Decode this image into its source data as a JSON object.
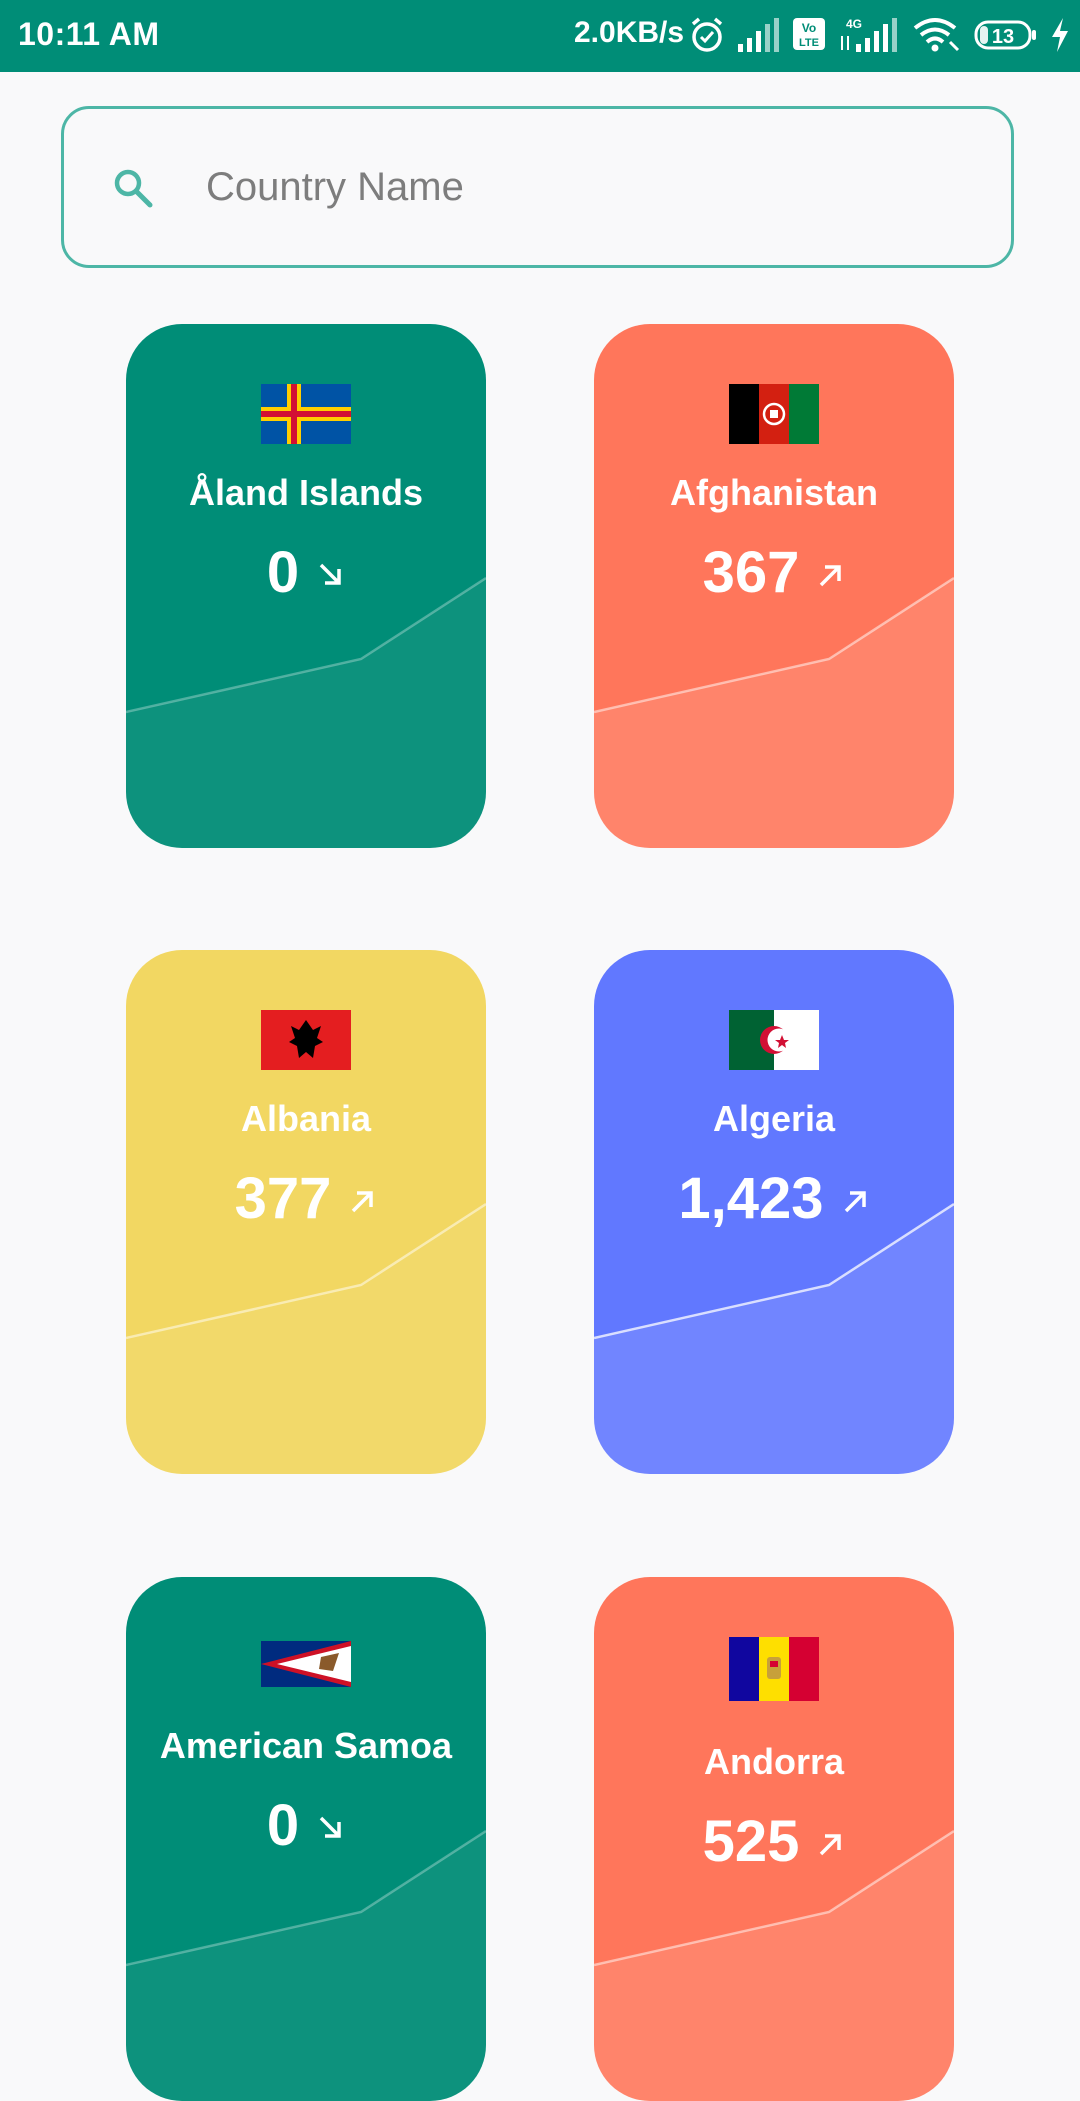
{
  "status_bar": {
    "time": "10:11 AM",
    "speed": "2.0KB/s",
    "battery": "13",
    "icons": [
      "alarm-icon",
      "signal-icon",
      "volte-icon",
      "4g-signal-icon",
      "wifi-icon",
      "battery-icon",
      "charging-icon"
    ],
    "background": "#008d77"
  },
  "search": {
    "placeholder": "Country Name",
    "value": "",
    "icon": "search-icon",
    "border_color": "#4db6a6"
  },
  "cards": [
    {
      "country": "Åland Islands",
      "count": "0",
      "trend": "down",
      "color": "#008d77",
      "flag": "aland-flag"
    },
    {
      "country": "Afghanistan",
      "count": "367",
      "trend": "up",
      "color": "#ff765b",
      "flag": "afghanistan-flag"
    },
    {
      "country": "Albania",
      "count": "377",
      "trend": "up",
      "color": "#f2d762",
      "flag": "albania-flag"
    },
    {
      "country": "Algeria",
      "count": "1,423",
      "trend": "up",
      "color": "#6178ff",
      "flag": "algeria-flag"
    },
    {
      "country": "American Samoa",
      "count": "0",
      "trend": "down",
      "color": "#008d77",
      "flag": "american-samoa-flag"
    },
    {
      "country": "Andorra",
      "count": "525",
      "trend": "up",
      "color": "#ff765b",
      "flag": "andorra-flag"
    }
  ]
}
